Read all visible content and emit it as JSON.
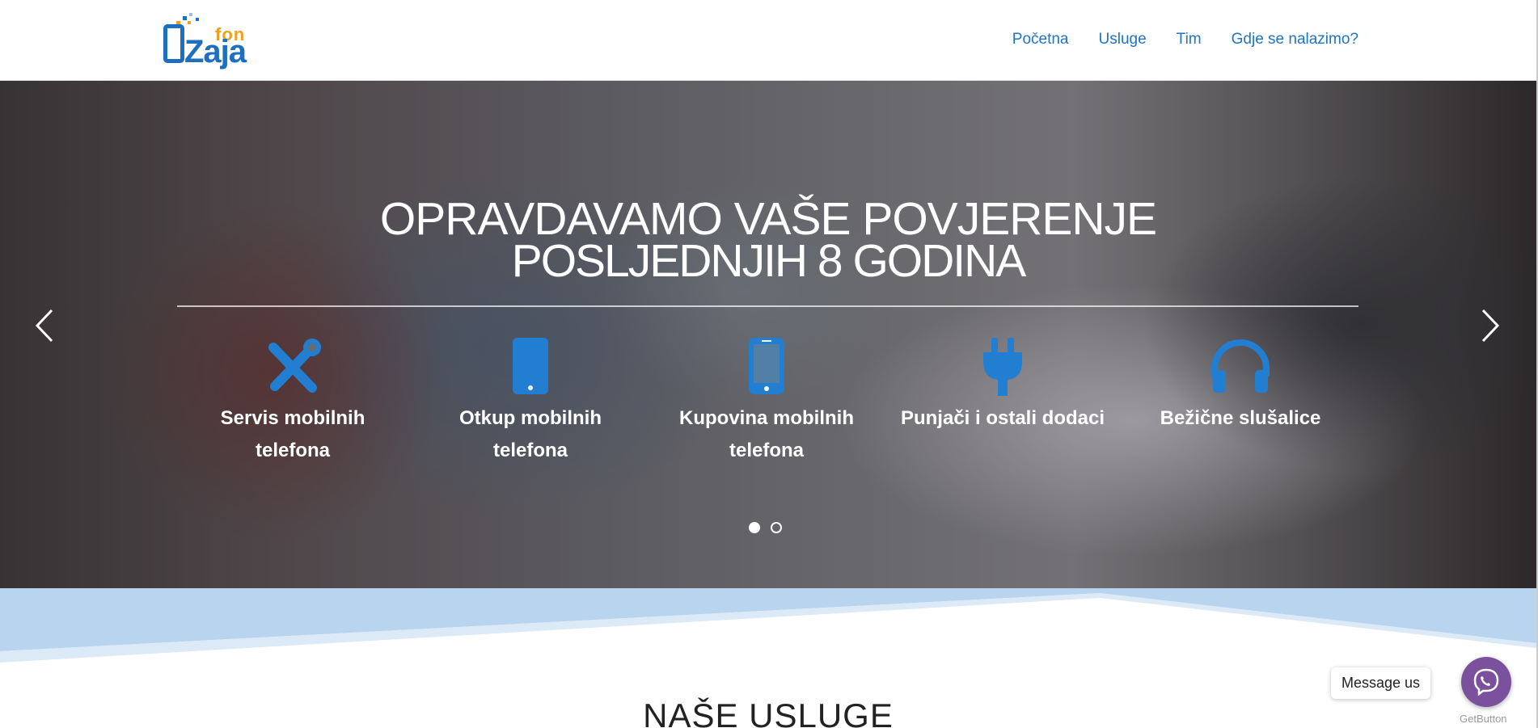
{
  "header": {
    "logo": {
      "brand_small": "fon",
      "brand_main": "Zaja"
    },
    "nav": [
      {
        "label": "Početna"
      },
      {
        "label": "Usluge"
      },
      {
        "label": "Tim"
      },
      {
        "label": "Gdje se nalazimo?"
      }
    ]
  },
  "hero": {
    "title_line1": "OPRAVDAVAMO VAŠE POVJERENJE",
    "title_line2": "POSLJEDNJIH 8 GODINA",
    "services": [
      {
        "label": "Servis mobilnih telefona",
        "icon": "tools-icon"
      },
      {
        "label": "Otkup mobilnih telefona",
        "icon": "tablet-icon"
      },
      {
        "label": "Kupovina mobilnih telefona",
        "icon": "mobile-phone-icon"
      },
      {
        "label": "Punjači i ostali dodaci",
        "icon": "plug-icon"
      },
      {
        "label": "Bežične slušalice",
        "icon": "headphones-icon"
      }
    ],
    "slides_total": 2,
    "active_slide": 1
  },
  "section": {
    "title": "NAŠE USLUGE"
  },
  "chat": {
    "message": "Message us",
    "powered_by": "GetButton",
    "color": "#7b519d"
  },
  "colors": {
    "accent": "#1f74c4",
    "icon_blue": "#1d6fc2",
    "wave_light": "#b8d4ee"
  }
}
